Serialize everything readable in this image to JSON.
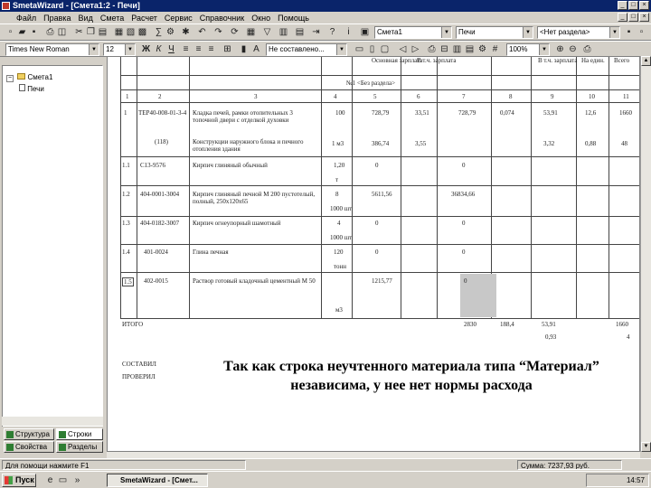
{
  "window": {
    "title": "SmetaWizard - [Смета1:2 - Печи]"
  },
  "menu": [
    "Файл",
    "Правка",
    "Вид",
    "Смета",
    "Расчет",
    "Сервис",
    "Справочник",
    "Окно",
    "Помощь"
  ],
  "toolbar1": {
    "combo_smeta": "Смета1",
    "combo_section": "Печи",
    "combo_razdel": "<Нет раздела>"
  },
  "toolbar2": {
    "font_name": "Times New Roman",
    "font_size": "12",
    "bold": "Ж",
    "italic": "К",
    "underline": "Ч",
    "style_combo": "Не составлено...",
    "zoom": "100%"
  },
  "tree": {
    "root": "Смета1",
    "child": "Печи"
  },
  "left_tabs": [
    "Структура",
    "Строки",
    "Свойства",
    "Разделы"
  ],
  "table": {
    "header_top": [
      "Основная зарплата",
      "В т.ч. зарплата",
      "В т.ч. зарплата",
      "На един.",
      "Всего"
    ],
    "section_label": "№1 <Без раздела>",
    "col_numbers": [
      "1",
      "2",
      "3",
      "4",
      "5",
      "6",
      "7",
      "8",
      "9",
      "10",
      "11"
    ],
    "rows": [
      {
        "n": "1",
        "code": "ТЕР40-008-01-3-4",
        "name": "Кладка печей, рамки отопительных 3 топочной двери с отделкой духовки",
        "unit": "100",
        "price": "728,79",
        "zp": "33,51",
        "total": "728,79",
        "x": "0,074",
        "e": "53,91",
        "f": "12,6",
        "g": "1660"
      },
      {
        "n": "",
        "code": "(118)",
        "name": "Конструкции наружного блока и печного отопления здания",
        "unit": "1 м3",
        "price": "386,74",
        "zp": "3,55",
        "total": "",
        "x": "",
        "e": "3,32",
        "f": "0,88",
        "g": "48"
      },
      {
        "n": "1.1",
        "code": "С13-9576",
        "name": "Кирпич глиняный обычный",
        "unit": "1,20",
        "price": "0",
        "zp": "",
        "total": "0",
        "x": "",
        "e": "",
        "f": "",
        "g": ""
      },
      {
        "n": "1.2",
        "code": "404-0001-3004",
        "name": "Кирпич глиняный печной М 200 пустотелый, полный, 250х120х65",
        "unit": "8",
        "price": "5611,56",
        "zp": "",
        "total": "36834,66",
        "x": "",
        "e": "",
        "f": "",
        "g": ""
      },
      {
        "n": "1.3",
        "code": "404-0182-3007",
        "name": "Кирпич огнеупорный шамотный",
        "unit": "4",
        "price": "0",
        "zp": "",
        "total": "0",
        "x": "",
        "e": "",
        "f": "",
        "g": ""
      },
      {
        "n": "1.4",
        "code": "401-0024",
        "name": "Глина печная",
        "unit": "120",
        "price": "0",
        "zp": "",
        "total": "0",
        "x": "",
        "e": "",
        "f": "",
        "g": ""
      },
      {
        "n": "1.5",
        "code": "402-0015",
        "name": "Раствор готовый кладочный цементный М 50",
        "unit": "",
        "price": "1215,77",
        "zp": "",
        "total": "0",
        "x": "",
        "e": "",
        "f": "",
        "g": ""
      }
    ],
    "unit_subs": [
      "т",
      "1000 шт",
      "1000 шт",
      "тонн",
      "м3"
    ],
    "total_label": "ИТОГО",
    "totals": {
      "a": "2830",
      "b": "188,4",
      "c": "53,91",
      "d": "1660"
    },
    "totals_sub": {
      "a": "0,93",
      "b": "4"
    }
  },
  "footer_labels": {
    "a": "СОСТАВИЛ",
    "b": "ПРОВЕРИЛ"
  },
  "caption": "Так как строка неучтенного материала типа “Материал” независима, у нее нет нормы расхода",
  "statusbar": {
    "left": "Для помощи нажмите F1",
    "price": "Сумма: 7237,93 руб."
  },
  "taskbar": {
    "start": "Пуск",
    "app": "SmetaWizard - [Смет...",
    "clock": "14:57"
  }
}
